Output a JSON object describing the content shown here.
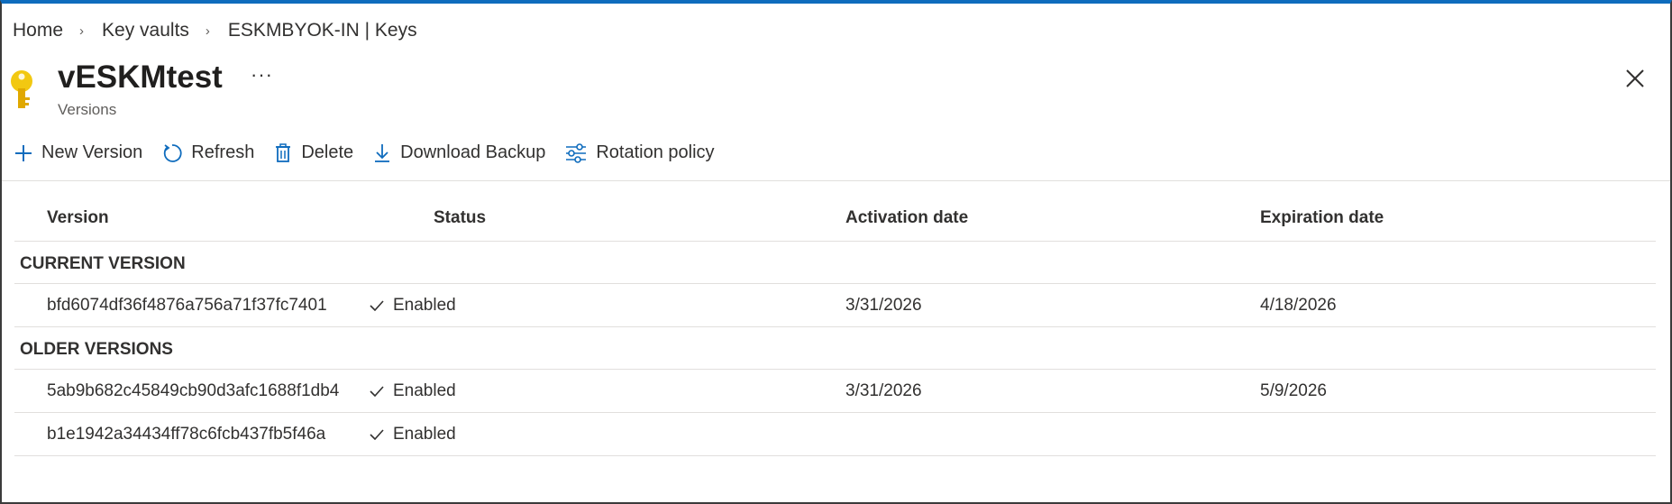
{
  "breadcrumb": {
    "items": [
      "Home",
      "Key vaults",
      "ESKMBYOK-IN | Keys"
    ],
    "separator": "›"
  },
  "header": {
    "title": "vESKMtest",
    "more": "···",
    "subtitle": "Versions",
    "icon": "key-icon"
  },
  "toolbar": {
    "new_version": "New Version",
    "refresh": "Refresh",
    "delete": "Delete",
    "download_backup": "Download Backup",
    "rotation_policy": "Rotation policy"
  },
  "table": {
    "columns": [
      "Version",
      "Status",
      "Activation date",
      "Expiration date"
    ],
    "groups": [
      {
        "label": "CURRENT VERSION",
        "rows": [
          {
            "version": "bfd6074df36f4876a756a71f37fc7401",
            "status": "Enabled",
            "activation": "3/31/2026",
            "expiration": "4/18/2026"
          }
        ]
      },
      {
        "label": "OLDER VERSIONS",
        "rows": [
          {
            "version": "5ab9b682c45849cb90d3afc1688f1db4",
            "status": "Enabled",
            "activation": "3/31/2026",
            "expiration": "5/9/2026"
          },
          {
            "version": "b1e1942a34434ff78c6fcb437fb5f46a",
            "status": "Enabled",
            "activation": "",
            "expiration": ""
          }
        ]
      }
    ]
  },
  "colors": {
    "accent": "#0f6cbd",
    "key_icon": "#f2c811",
    "text": "#323130"
  }
}
